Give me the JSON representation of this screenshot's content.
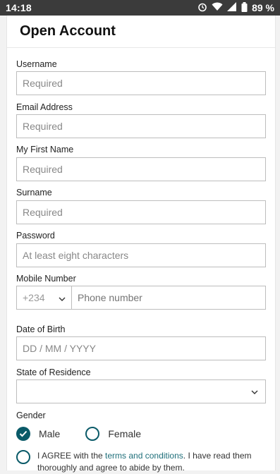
{
  "status_bar": {
    "time": "14:18",
    "battery": "89 %",
    "icons": [
      "alarm-icon",
      "wifi-icon",
      "signal-icon",
      "battery-icon"
    ]
  },
  "page": {
    "title": "Open Account"
  },
  "fields": {
    "username": {
      "label": "Username",
      "placeholder": "Required"
    },
    "email": {
      "label": "Email Address",
      "placeholder": "Required"
    },
    "first_name": {
      "label": "My First Name",
      "placeholder": "Required"
    },
    "surname": {
      "label": "Surname",
      "placeholder": "Required"
    },
    "password": {
      "label": "Password",
      "placeholder": "At least eight characters"
    },
    "mobile": {
      "label": "Mobile Number",
      "country_code": "+234",
      "placeholder": "Phone number"
    },
    "dob": {
      "label": "Date of Birth",
      "placeholder": "DD / MM / YYYY"
    },
    "state": {
      "label": "State of Residence",
      "value": ""
    },
    "gender": {
      "label": "Gender",
      "options": [
        "Male",
        "Female"
      ],
      "selected": "Male"
    }
  },
  "agreement": {
    "prefix": "I AGREE with the ",
    "link": "terms and conditions",
    "suffix": ". I have read them thoroughly and agree to abide by them."
  },
  "colors": {
    "accent": "#0a5a68",
    "link": "#1f6f7a",
    "status_bar": "#3b3b3b"
  }
}
